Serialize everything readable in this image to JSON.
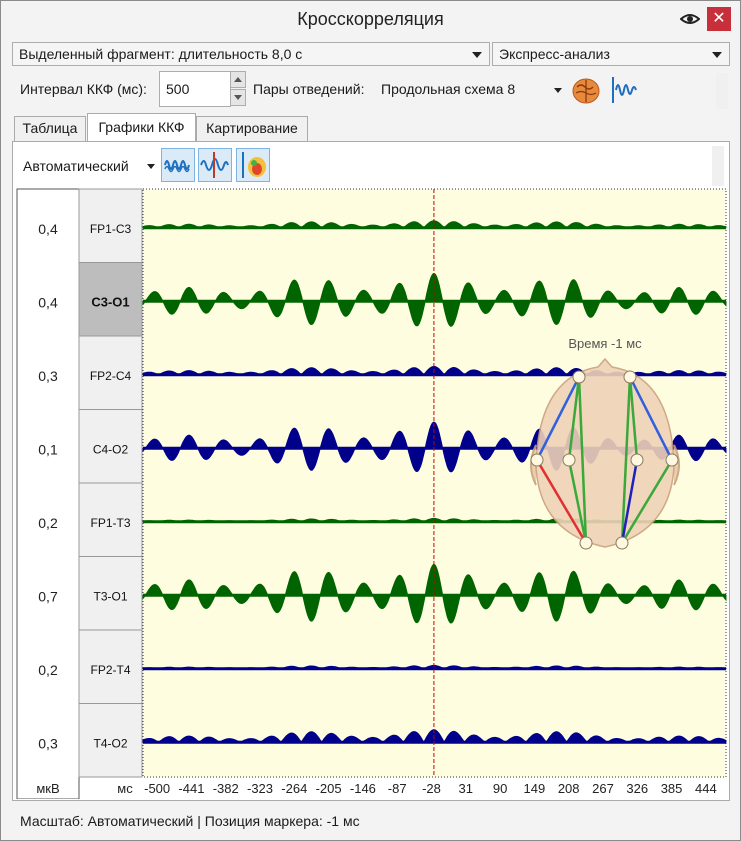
{
  "window": {
    "title": "Кросскорреляция"
  },
  "toolbar": {
    "fragment_select": "Выделенный фрагмент: длительность 8,0 с",
    "analysis_select": "Экспресс-анализ",
    "interval_label": "Интервал ККФ (мс):",
    "interval_value": "500",
    "pairs_label": "Пары отведений:",
    "pairs_select": "Продольная схема 8"
  },
  "tabs": [
    {
      "label": "Таблица",
      "active": false
    },
    {
      "label": "Графики ККФ",
      "active": true
    },
    {
      "label": "Картирование",
      "active": false
    }
  ],
  "chart_toolbar": {
    "scale_select": "Автоматический"
  },
  "colors": {
    "green": "#006400",
    "blue": "#00008b",
    "background": "#fffde0",
    "marker": "#cc0000"
  },
  "chart_data": {
    "type": "line",
    "xlabel": "мс",
    "ylabel": "мкВ",
    "xlim": [
      -500,
      500
    ],
    "marker_position": -1,
    "x_ticks": [
      "-500",
      "-441",
      "-382",
      "-323",
      "-264",
      "-205",
      "-146",
      "-87",
      "-28",
      "31",
      "90",
      "149",
      "208",
      "267",
      "326",
      "385",
      "444"
    ],
    "series": [
      {
        "name": "FP1-C3",
        "scale": "0,4",
        "color": "green",
        "amp": 0.25,
        "selected": false
      },
      {
        "name": "C3-O1",
        "scale": "0,4",
        "color": "green",
        "amp": 0.9,
        "selected": true
      },
      {
        "name": "FP2-C4",
        "scale": "0,3",
        "color": "blue",
        "amp": 0.3,
        "selected": false
      },
      {
        "name": "C4-O2",
        "scale": "0,1",
        "color": "blue",
        "amp": 0.85,
        "selected": false
      },
      {
        "name": "FP1-T3",
        "scale": "0,2",
        "color": "green",
        "amp": 0.12,
        "selected": false
      },
      {
        "name": "T3-O1",
        "scale": "0,7",
        "color": "green",
        "amp": 1.0,
        "selected": false
      },
      {
        "name": "FP2-T4",
        "scale": "0,2",
        "color": "blue",
        "amp": 0.12,
        "selected": false
      },
      {
        "name": "T4-O2",
        "scale": "0,3",
        "color": "blue",
        "amp": 0.45,
        "selected": false
      }
    ]
  },
  "head_map": {
    "label": "Время -1 мс"
  },
  "status": {
    "text": "Масштаб: Автоматический  | Позиция маркера: -1 мс"
  }
}
